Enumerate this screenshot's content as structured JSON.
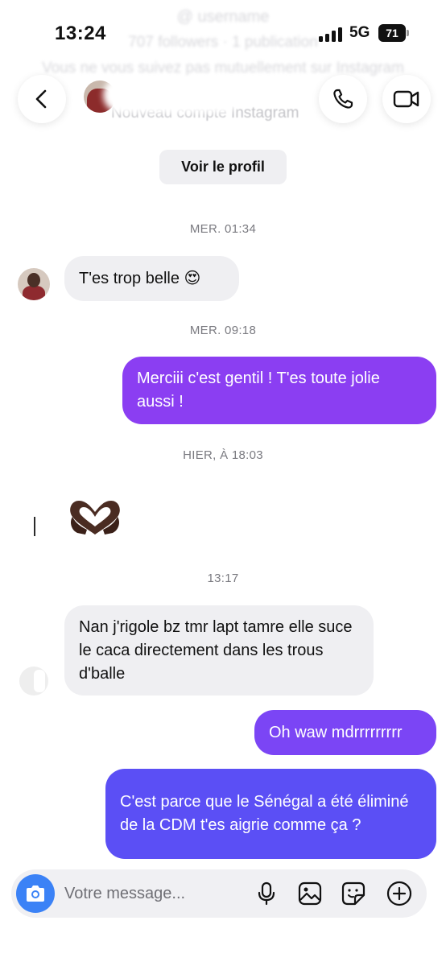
{
  "status": {
    "time": "13:24",
    "network": "5G",
    "battery": "71"
  },
  "header_bg": {
    "line1": "@ username",
    "line2": "707 followers · 1 publication",
    "line3": "Vous ne vous suivez pas mutuellement sur Instagram"
  },
  "header": {
    "subtitle": "Nouveau compte Instagram"
  },
  "profile_button": "Voir le profil",
  "timestamps": [
    "MER. 01:34",
    "MER. 09:18",
    "HIER, À 18:03",
    "13:17"
  ],
  "messages": [
    {
      "dir": "in",
      "text": "T'es trop belle 😍"
    },
    {
      "dir": "out",
      "text": "Merciii c'est gentil ! T'es toute jolie aussi !"
    },
    {
      "dir": "in",
      "text": "🫶🏿",
      "emoji_only": true
    },
    {
      "dir": "in",
      "text": "Nan j'rigole bz tmr lapt tamre elle suce le caca directement dans les trous d'balle"
    },
    {
      "dir": "out",
      "text": "Oh waw mdrrrrrrrrr"
    },
    {
      "dir": "out",
      "text": "C'est parce que le Sénégal a été éliminé de la CDM t'es aigrie comme ça ?"
    }
  ],
  "composer": {
    "placeholder": "Votre message..."
  },
  "colors": {
    "outgoing_top": "#8b3ef2",
    "outgoing_mid": "#7b45f5",
    "outgoing_bottom": "#5b4ff5",
    "camera_button": "#3b82f6",
    "incoming": "#efeff2"
  },
  "icons": [
    "back-arrow-icon",
    "phone-icon",
    "video-camera-icon",
    "camera-icon",
    "microphone-icon",
    "image-icon",
    "sticker-icon",
    "plus-icon"
  ]
}
